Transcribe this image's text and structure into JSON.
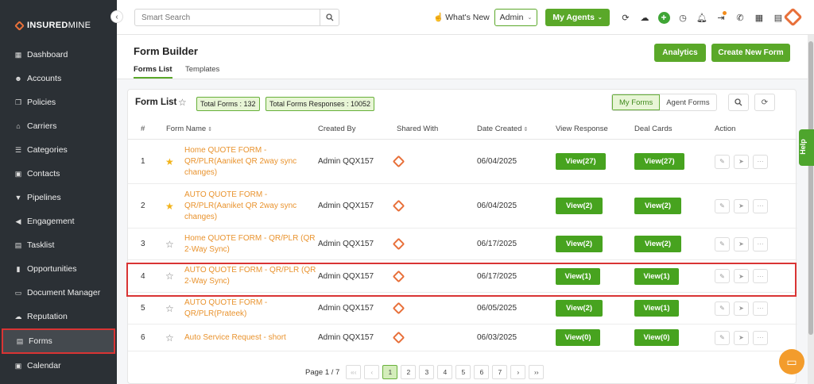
{
  "sidebar": {
    "brand_bold": "INSURED",
    "brand_rest": "MINE",
    "collapse_icon": "‹",
    "items": [
      {
        "label": "Dashboard",
        "icon": "dashboard-icon"
      },
      {
        "label": "Accounts",
        "icon": "accounts-icon"
      },
      {
        "label": "Policies",
        "icon": "policies-icon"
      },
      {
        "label": "Carriers",
        "icon": "carriers-icon"
      },
      {
        "label": "Categories",
        "icon": "categories-icon"
      },
      {
        "label": "Contacts",
        "icon": "contacts-icon"
      },
      {
        "label": "Pipelines",
        "icon": "pipelines-icon"
      },
      {
        "label": "Engagement",
        "icon": "engagement-icon"
      },
      {
        "label": "Tasklist",
        "icon": "tasklist-icon"
      },
      {
        "label": "Opportunities",
        "icon": "opportunities-icon"
      },
      {
        "label": "Document Manager",
        "icon": "document-manager-icon"
      },
      {
        "label": "Reputation",
        "icon": "reputation-icon"
      },
      {
        "label": "Forms",
        "icon": "forms-icon",
        "active": true
      },
      {
        "label": "Calendar",
        "icon": "calendar-icon"
      }
    ]
  },
  "topbar": {
    "search_placeholder": "Smart Search",
    "whats_new": "What's New",
    "admin_select": "Admin",
    "my_agents": "My Agents"
  },
  "form_builder": {
    "title": "Form Builder",
    "tabs": [
      "Forms List",
      "Templates"
    ],
    "analytics_label": "Analytics",
    "create_label": "Create New Form"
  },
  "form_list": {
    "title": "Form List",
    "total_forms": "Total Forms : 132",
    "total_responses": "Total Forms Responses : 10052",
    "my_forms": "My Forms",
    "agent_forms": "Agent Forms",
    "columns": {
      "num": "#",
      "name": "Form Name",
      "created_by": "Created By",
      "shared_with": "Shared With",
      "date_created": "Date Created",
      "view_response": "View Response",
      "deal_cards": "Deal Cards",
      "action": "Action"
    },
    "rows": [
      {
        "num": "1",
        "starred": true,
        "name": "Home QUOTE FORM - QR/PLR(Aaniket QR 2way sync changes)",
        "created_by": "Admin QQX157",
        "date": "06/04/2025",
        "view_response": "View(27)",
        "deal_cards": "View(27)"
      },
      {
        "num": "2",
        "starred": true,
        "name": "AUTO QUOTE FORM - QR/PLR(Aaniket QR 2way sync changes)",
        "created_by": "Admin QQX157",
        "date": "06/04/2025",
        "view_response": "View(2)",
        "deal_cards": "View(2)"
      },
      {
        "num": "3",
        "starred": false,
        "name": "Home QUOTE FORM - QR/PLR (QR 2-Way Sync)",
        "created_by": "Admin QQX157",
        "date": "06/17/2025",
        "view_response": "View(2)",
        "deal_cards": "View(2)"
      },
      {
        "num": "4",
        "starred": false,
        "name": "AUTO QUOTE FORM - QR/PLR (QR 2-Way Sync)",
        "created_by": "Admin QQX157",
        "date": "06/17/2025",
        "view_response": "View(1)",
        "deal_cards": "View(1)"
      },
      {
        "num": "5",
        "starred": false,
        "name": "AUTO QUOTE FORM - QR/PLR(Prateek)",
        "created_by": "Admin QQX157",
        "date": "06/05/2025",
        "view_response": "View(2)",
        "deal_cards": "View(1)"
      },
      {
        "num": "6",
        "starred": false,
        "name": "Auto Service Request - short",
        "created_by": "Admin QQX157",
        "date": "06/03/2025",
        "view_response": "View(0)",
        "deal_cards": "View(0)"
      }
    ]
  },
  "pagination": {
    "info": "Page 1 / 7",
    "first": "«‹",
    "prev": "‹",
    "pages": [
      "1",
      "2",
      "3",
      "4",
      "5",
      "6",
      "7"
    ],
    "current": "1",
    "next": "›",
    "last": "››"
  },
  "help_label": "Help",
  "colors": {
    "accent": "#5aa829",
    "brand": "#e8703a",
    "link": "#e9932e",
    "sidebar": "#2b3035",
    "highlight": "#d93434"
  }
}
